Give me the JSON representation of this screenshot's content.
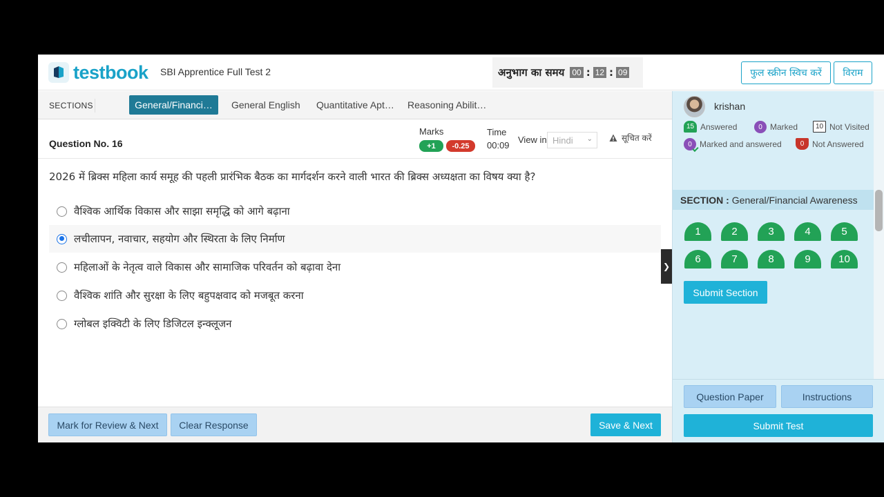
{
  "header": {
    "logo_text": "testbook",
    "test_title": "SBI Apprentice Full Test 2",
    "timer_label": "अनुभाग का समय",
    "timer": {
      "hh": "00",
      "mm": "12",
      "ss": "09"
    },
    "fullscreen_label": "फुल स्क्रीन स्विच करें",
    "pause_label": "विराम"
  },
  "sections": {
    "label": "SECTIONS",
    "tabs": [
      {
        "label": "General/Financi…",
        "active": true
      },
      {
        "label": "General English",
        "active": false
      },
      {
        "label": "Quantitative Apt…",
        "active": false
      },
      {
        "label": "Reasoning Abilit…",
        "active": false
      }
    ]
  },
  "question": {
    "number_label": "Question No. 16",
    "marks_label": "Marks",
    "marks_positive": "+1",
    "marks_negative": "-0.25",
    "time_label": "Time",
    "time_value": "00:09",
    "view_in_label": "View in",
    "language": "Hindi",
    "report_label": "सूचित करें",
    "text": "2026 में ब्रिक्स महिला कार्य समूह की पहली प्रारंभिक बैठक का मार्गदर्शन करने वाली भारत की ब्रिक्स अध्यक्षता का विषय क्या है?",
    "options": [
      {
        "text": "वैश्विक आर्थिक विकास और साझा समृद्धि को आगे बढ़ाना",
        "selected": false
      },
      {
        "text": "लचीलापन, नवाचार, सहयोग और स्थिरता के लिए निर्माण",
        "selected": true
      },
      {
        "text": "महिलाओं के नेतृत्व वाले विकास और सामाजिक परिवर्तन को बढ़ावा देना",
        "selected": false
      },
      {
        "text": "वैश्विक शांति और सुरक्षा के लिए बहुपक्षवाद को मजबूत करना",
        "selected": false
      },
      {
        "text": "ग्लोबल इक्विटी के लिए डिजिटल इन्क्लूजन",
        "selected": false
      }
    ]
  },
  "footer": {
    "mark_review_label": "Mark for Review & Next",
    "clear_label": "Clear Response",
    "save_next_label": "Save & Next"
  },
  "panel": {
    "user_name": "krishan",
    "legend": {
      "answered_count": "15",
      "answered_label": "Answered",
      "marked_count": "0",
      "marked_label": "Marked",
      "not_visited_count": "10",
      "not_visited_label": "Not Visited",
      "marked_answered_count": "0",
      "marked_answered_label": "Marked and answered",
      "not_answered_count": "0",
      "not_answered_label": "Not Answered"
    },
    "section_label": "SECTION :",
    "section_name": "General/Financial Awareness",
    "question_numbers": [
      "1",
      "2",
      "3",
      "4",
      "5",
      "6",
      "7",
      "8",
      "9",
      "10"
    ],
    "submit_section_label": "Submit Section",
    "question_paper_label": "Question Paper",
    "instructions_label": "Instructions",
    "submit_test_label": "Submit Test"
  },
  "colors": {
    "brand": "#19a2c8",
    "active_tab": "#1f7a96",
    "answered_green": "#22a256",
    "negative_red": "#d33a2c",
    "panel_bg": "#d8eef7"
  }
}
